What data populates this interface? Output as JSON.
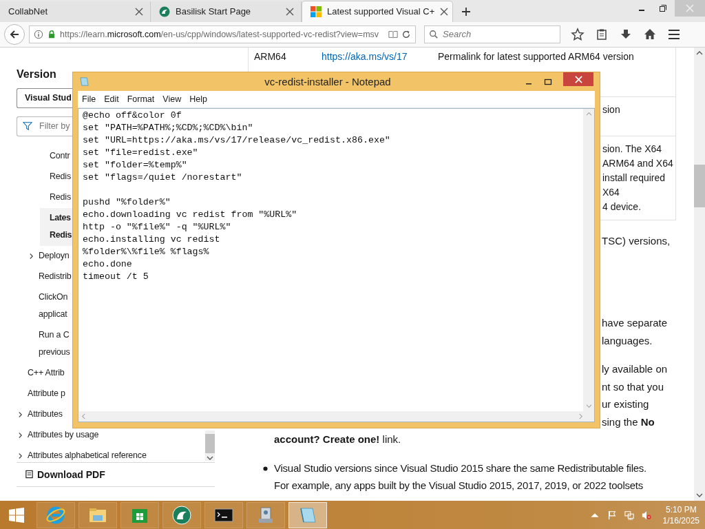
{
  "browser": {
    "tabs": [
      {
        "title": "CollabNet",
        "selected": false
      },
      {
        "title": "Basilisk Start Page",
        "selected": false
      },
      {
        "title": "Latest supported Visual C+",
        "selected": true
      }
    ],
    "url_start": "https://learn.",
    "url_domain": "microsoft.com",
    "url_rest": "/en-us/cpp/windows/latest-supported-vc-redist?view=msv",
    "search_placeholder": "Search"
  },
  "sidebar": {
    "heading": "Version",
    "version_select": "Visual Stud",
    "filter_placeholder": "Filter by",
    "items": [
      {
        "children": [
          {
            "children": [
              {
                "label": "Contr",
                "selected": false,
                "collapsed": false
              },
              {
                "label": "Redis",
                "selected": false,
                "collapsed": false
              },
              {
                "label": "Redis",
                "selected": false,
                "collapsed": false
              },
              {
                "label": "Lates\nRedis",
                "selected": true,
                "collapsed": false
              }
            ]
          },
          {
            "label": "Deployn",
            "selected": false,
            "collapsed": true
          },
          {
            "label": "Redistrib",
            "selected": false,
            "collapsed": false
          },
          {
            "label": "ClickOn\napplicat",
            "selected": false,
            "collapsed": false
          },
          {
            "label": "Run a C\nprevious",
            "selected": false,
            "collapsed": false
          }
        ]
      },
      {
        "label": "C++ Attrib",
        "selected": false,
        "collapsed": false
      },
      {
        "label": "Attribute p",
        "selected": false,
        "collapsed": false
      },
      {
        "label": "Attributes",
        "selected": false,
        "collapsed": true
      },
      {
        "label": "Attributes by usage",
        "selected": false,
        "collapsed": true
      },
      {
        "label": "Attributes alphabetical reference",
        "selected": false,
        "collapsed": true
      }
    ],
    "download": "Download PDF"
  },
  "article": {
    "table_rows": [
      {
        "architecture": "ARM64",
        "link": "https://aka.ms/vs/17",
        "description": "Permalink for latest supported ARM64 version"
      },
      {
        "description": "sion"
      },
      {
        "description": "sion. The X64\nARM64 and X64\ninstall required\nX64\n4 device."
      }
    ],
    "fragments": [
      "TSC) versions,",
      "have separate\nlanguages.",
      "ly available on\nnt so that you\nur existing\nsing the **No**"
    ],
    "continuation": "**account? Create one!** link.",
    "bullets": [
      "Visual Studio versions since Visual Studio 2015 share the same Redistributable files.\nFor example, any apps built by the Visual Studio 2015, 2017, 2019, or 2022 toolsets"
    ]
  },
  "notepad": {
    "title": "vc-redist-installer - Notepad",
    "menu": [
      "File",
      "Edit",
      "Format",
      "View",
      "Help"
    ],
    "text": "@echo off&color 0f\nset \"PATH=%PATH%;%CD%;%CD%\\bin\"\nset \"URL=https://aka.ms/vs/17/release/vc_redist.x86.exe\"\nset \"file=redist.exe\"\nset \"folder=%temp%\"\nset \"flags=/quiet /norestart\"\n\npushd \"%folder%\"\necho.downloading vc redist from \"%URL%\"\nhttp -o \"%file%\" -q \"%URL%\"\necho.installing vc redist\n%folder%\\%file% %flags%\necho.done\ntimeout /t 5"
  },
  "taskbar": {
    "apps": [
      {
        "kind": "ie",
        "selected": false
      },
      {
        "kind": "folder",
        "selected": false
      },
      {
        "kind": "store",
        "selected": false
      },
      {
        "kind": "basilisk",
        "selected": false
      },
      {
        "kind": "cmd",
        "selected": false
      },
      {
        "kind": "installer",
        "selected": false
      },
      {
        "kind": "notepad",
        "selected": true
      }
    ],
    "time": "5:10 PM",
    "date": "1/16/2025"
  }
}
